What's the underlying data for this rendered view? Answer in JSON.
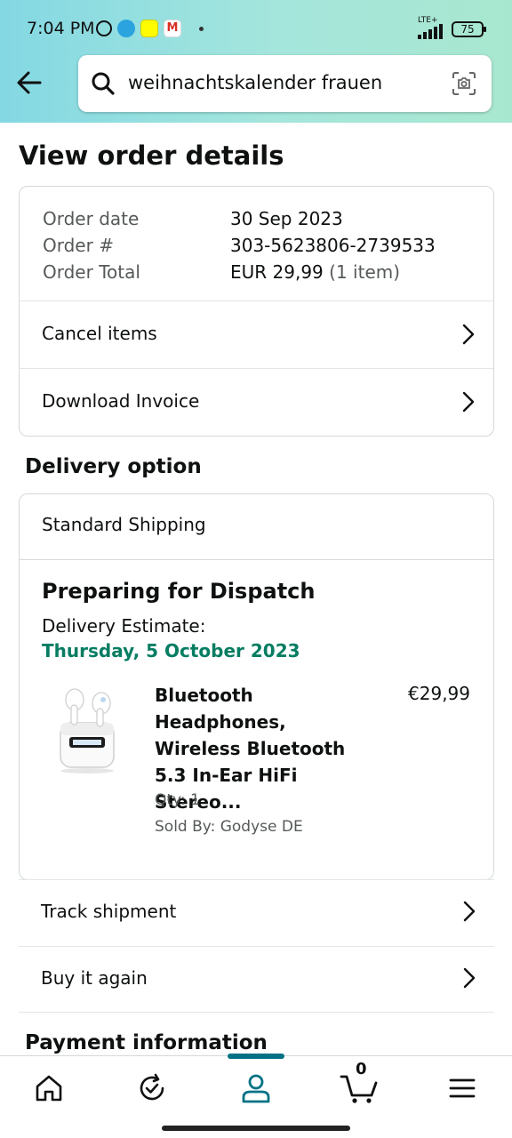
{
  "status_bar": {
    "time": "7:04 PM",
    "network": "LTE+",
    "battery": "75",
    "gmail_glyph": "M"
  },
  "search": {
    "query": "weihnachtskalender frauen"
  },
  "page": {
    "title": "View order details"
  },
  "order_summary": {
    "date_label": "Order date",
    "date_value": "30 Sep 2023",
    "number_label": "Order #",
    "number_value": "303-5623806-2739533",
    "total_label": "Order Total",
    "total_value": "EUR 29,99",
    "item_count": "(1 item)",
    "actions": [
      {
        "label": "Cancel items"
      },
      {
        "label": "Download Invoice"
      }
    ]
  },
  "delivery": {
    "section_title": "Delivery option",
    "method": "Standard Shipping",
    "status": "Preparing for Dispatch",
    "estimate_label": "Delivery Estimate:",
    "estimate_date": "Thursday, 5 October 2023",
    "product": {
      "title": "Bluetooth Headphones, Wireless Bluetooth 5.3 In-Ear HiFi Stereo...",
      "price": "€29,99",
      "qty": "Qty: 1",
      "seller": "Sold By: Godyse DE"
    },
    "actions": [
      {
        "label": "Track shipment"
      },
      {
        "label": "Buy it again"
      }
    ]
  },
  "payment": {
    "section_title": "Payment information"
  },
  "bottom_nav": {
    "items": [
      "home-icon",
      "orders-refresh-icon",
      "account-icon",
      "cart-icon",
      "menu-icon"
    ],
    "active": "account-icon",
    "cart_count": "0"
  },
  "colors": {
    "accent": "#007185",
    "delivery_green": "#067d62",
    "header_start": "#84d8e3",
    "header_end": "#a8e7cf"
  }
}
